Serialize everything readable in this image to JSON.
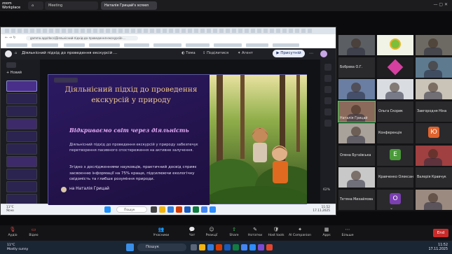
{
  "zoom": {
    "brand": "zoom\nWorkplace",
    "tabs": [
      "Home",
      "Meeting",
      "Наталія Грицай's screen"
    ],
    "active_tab": 2,
    "top_right": "— ▢ ✕"
  },
  "browser": {
    "url": "gamma.app/docs/Дiяльнiсний-пiдхiд-до-проведення-екскурсiй-..."
  },
  "gamma": {
    "doc_title": "Діяльнісний підхід до проведення екскурсій ...",
    "nav": [
      "Тема",
      "Поділитися",
      "Агент"
    ],
    "present_label": "Присутній",
    "share_note": "Увімкнено віддалене керування · Ctrl+Enter",
    "new_label": "+ Новий",
    "zoom_pct": "62%"
  },
  "slide": {
    "title": "Діяльнісний підхід до проведення екскурсій у природу",
    "subtitle": "Відкриваємо світ через діяльність",
    "p1": "Діяльнісний підхід до проведення екскурсій у природу забезпечує перетворення пасивного спостереження на активне залучення.",
    "p2": "Згідно з дослідженнями науковців, практичний досвід сприяє засвоєнню інформації на 75% краще, підсилюючи екологічну свідомість та глибше розуміння природи.",
    "author": "на Наталія Грицай"
  },
  "inner_taskbar": {
    "weather": "11°C\nЯсно",
    "search": "Пошук",
    "clock": "11:52\n17.11.2025"
  },
  "gallery": {
    "tiles": [
      {
        "name": "",
        "kind": "video",
        "color": "#5b5f63"
      },
      {
        "name": "",
        "kind": "logo",
        "color": "#f0f3e6"
      },
      {
        "name": "",
        "kind": "video",
        "color": "#6c6a63"
      },
      {
        "name": "Бобрева О.Г.",
        "kind": "empty",
        "color": "#2a2a2d"
      },
      {
        "name": "",
        "kind": "logo2",
        "color": "#1f1f22"
      },
      {
        "name": "",
        "kind": "video",
        "color": "#5d7a8f"
      },
      {
        "name": "",
        "kind": "video",
        "color": "#6a7ea3"
      },
      {
        "name": "",
        "kind": "video",
        "color": "#d9dde2"
      },
      {
        "name": "",
        "kind": "video",
        "color": "#c9c3b8"
      },
      {
        "name": "Наталія Грицай",
        "kind": "speaker",
        "color": "#8a6a5a"
      },
      {
        "name": "Ольга Скорик",
        "kind": "empty",
        "color": "#2a2a2d"
      },
      {
        "name": "Завгородня Ніна",
        "kind": "empty",
        "color": "#2a2a2d"
      },
      {
        "name": "",
        "kind": "video",
        "color": "#a9a29a"
      },
      {
        "name": "Конференція",
        "kind": "empty",
        "color": "#2a2a2d"
      },
      {
        "name": "",
        "kind": "letter",
        "letter": "Ю",
        "color": "#e0632e"
      },
      {
        "name": "Олена Бугаївська",
        "kind": "empty",
        "color": "#2a2a2d"
      },
      {
        "name": "",
        "kind": "letter",
        "letter": "E",
        "color": "#4a9a3a"
      },
      {
        "name": "",
        "kind": "video",
        "color": "#a04040"
      },
      {
        "name": "",
        "kind": "video",
        "color": "#c8c8c8"
      },
      {
        "name": "Кравченко Олександр",
        "kind": "empty",
        "color": "#2a2a2d"
      },
      {
        "name": "Валерія Кравчук",
        "kind": "empty",
        "color": "#2a2a2d"
      },
      {
        "name": "Тетяна Михайлова",
        "kind": "empty",
        "color": "#2a2a2d"
      },
      {
        "name": "",
        "kind": "letter",
        "letter": "O",
        "color": "#7a3fb0"
      },
      {
        "name": "",
        "kind": "video",
        "color": "#9a8a80"
      }
    ]
  },
  "controls": {
    "items": [
      "Аудіо",
      "Відео",
      "Учасники",
      "Чат",
      "Реакції",
      "Share",
      "Нотатки",
      "Host tools",
      "AI Companion",
      "Apps",
      "Більше"
    ],
    "end": "End"
  },
  "windows": {
    "weather": "11°C\nMostly sunny",
    "search": "Пошук",
    "clock": "11:52\n17.11.2025"
  },
  "colors": {
    "slide_bg": "#27185a",
    "title": "#f0c98d",
    "subtitle": "#e2a8f4",
    "end_button": "#c92b2b"
  }
}
